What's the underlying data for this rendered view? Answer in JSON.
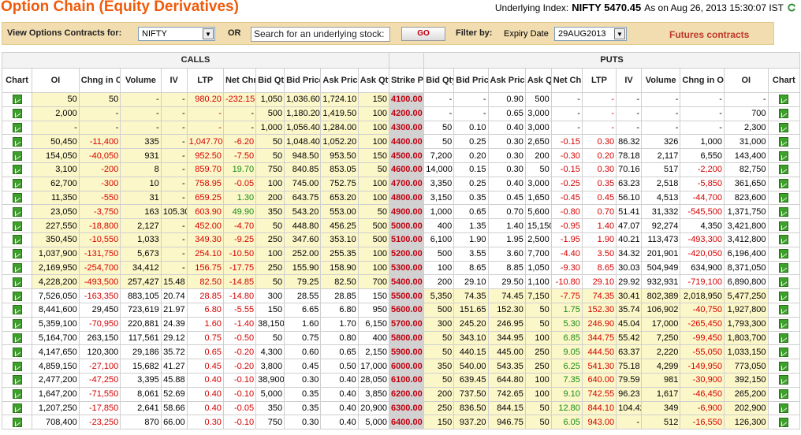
{
  "page": {
    "title": "Option Chain (Equity Derivatives)"
  },
  "underlying": {
    "label": "Underlying Index:",
    "symbol_value": "NIFTY 5470.45",
    "as_on": "As on Aug 26, 2013 15:30:07 IST"
  },
  "filter": {
    "view_label": "View Options Contracts for:",
    "symbol_selected": "NIFTY",
    "or_label": "OR",
    "search_value": "Search for an underlying stock:",
    "go_label": "GO",
    "filter_label": "Filter by:",
    "expiry_label": "Expiry Date",
    "expiry_selected": "29AUG2013",
    "futures_link": "Futures contracts"
  },
  "groups": {
    "calls": "CALLS",
    "puts": "PUTS"
  },
  "columns": {
    "calls": [
      "Chart",
      "OI",
      "Chng in OI",
      "Volume",
      "IV",
      "LTP",
      "Net Chng",
      "Bid Qty",
      "Bid Price",
      "Ask Price",
      "Ask Qty"
    ],
    "strike": "Strike Price",
    "puts": [
      "Bid Qty",
      "Bid Price",
      "Ask Price",
      "Ask Qty",
      "Net Chng",
      "LTP",
      "IV",
      "Volume",
      "Chng in OI",
      "OI",
      "Chart"
    ]
  },
  "icons": {
    "chart": "chart-icon",
    "refresh": "refresh-icon",
    "dropdown": "chevron-down-icon"
  },
  "colors": {
    "title": "#f05a0a",
    "itm": "#fcf7c8",
    "strike_bg": "#d2d2d2",
    "strike_text": "#c0000e",
    "negative": "#d60000",
    "positive": "#178a17",
    "chart_icon": "#3f9f2c"
  },
  "rows": [
    {
      "strike": "4100.00",
      "call": [
        "50",
        "50",
        "-",
        "-",
        "980.20",
        "-232.15",
        "1,050",
        "1,036.60",
        "1,724.10",
        "150"
      ],
      "put": [
        "-",
        "-",
        "0.90",
        "500",
        "-",
        "-",
        "-",
        "-",
        "-",
        "-"
      ]
    },
    {
      "strike": "4200.00",
      "call": [
        "2,000",
        "-",
        "-",
        "-",
        "-",
        "-",
        "500",
        "1,180.20",
        "1,419.50",
        "100"
      ],
      "put": [
        "-",
        "-",
        "0.65",
        "3,000",
        "-",
        "-",
        "-",
        "-",
        "-",
        "700"
      ]
    },
    {
      "strike": "4300.00",
      "call": [
        "-",
        "-",
        "-",
        "-",
        "-",
        "-",
        "1,000",
        "1,056.40",
        "1,284.00",
        "100"
      ],
      "put": [
        "50",
        "0.10",
        "0.40",
        "3,000",
        "-",
        "-",
        "-",
        "-",
        "-",
        "2,300"
      ]
    },
    {
      "strike": "4400.00",
      "call": [
        "50,450",
        "-11,400",
        "335",
        "-",
        "1,047.70",
        "-6.20",
        "50",
        "1,048.40",
        "1,052.20",
        "100"
      ],
      "put": [
        "50",
        "0.25",
        "0.30",
        "2,650",
        "-0.15",
        "0.30",
        "86.32",
        "326",
        "1,000",
        "31,000"
      ]
    },
    {
      "strike": "4500.00",
      "call": [
        "154,050",
        "-40,050",
        "931",
        "-",
        "952.50",
        "-7.50",
        "50",
        "948.50",
        "953.50",
        "150"
      ],
      "put": [
        "7,200",
        "0.20",
        "0.30",
        "200",
        "-0.30",
        "0.20",
        "78.18",
        "2,117",
        "6,550",
        "143,400"
      ]
    },
    {
      "strike": "4600.00",
      "call": [
        "3,100",
        "-200",
        "8",
        "-",
        "859.70",
        "19.70",
        "750",
        "840.85",
        "853.05",
        "50"
      ],
      "put": [
        "14,000",
        "0.15",
        "0.30",
        "50",
        "-0.15",
        "0.30",
        "70.16",
        "517",
        "-2,200",
        "82,750"
      ]
    },
    {
      "strike": "4700.00",
      "call": [
        "62,700",
        "-300",
        "10",
        "-",
        "758.95",
        "-0.05",
        "100",
        "745.00",
        "752.75",
        "100"
      ],
      "put": [
        "3,350",
        "0.25",
        "0.40",
        "3,000",
        "-0.25",
        "0.35",
        "63.23",
        "2,518",
        "-5,850",
        "361,650"
      ]
    },
    {
      "strike": "4800.00",
      "call": [
        "11,350",
        "-550",
        "31",
        "-",
        "659.25",
        "1.30",
        "200",
        "643.75",
        "653.20",
        "100"
      ],
      "put": [
        "3,150",
        "0.35",
        "0.45",
        "1,650",
        "-0.45",
        "0.45",
        "56.10",
        "4,513",
        "-44,700",
        "823,600"
      ]
    },
    {
      "strike": "4900.00",
      "call": [
        "23,050",
        "-3,750",
        "163",
        "105.30",
        "603.90",
        "49.90",
        "350",
        "543.20",
        "553.00",
        "50"
      ],
      "put": [
        "1,000",
        "0.65",
        "0.70",
        "5,600",
        "-0.80",
        "0.70",
        "51.41",
        "31,332",
        "-545,500",
        "1,371,750"
      ]
    },
    {
      "strike": "5000.00",
      "call": [
        "227,550",
        "-18,800",
        "2,127",
        "-",
        "452.00",
        "-4.70",
        "50",
        "448.80",
        "456.25",
        "500"
      ],
      "put": [
        "400",
        "1.35",
        "1.40",
        "15,150",
        "-0.95",
        "1.40",
        "47.07",
        "92,274",
        "4,350",
        "3,421,800"
      ]
    },
    {
      "strike": "5100.00",
      "call": [
        "350,450",
        "-10,550",
        "1,033",
        "-",
        "349.30",
        "-9.25",
        "250",
        "347.60",
        "353.10",
        "500"
      ],
      "put": [
        "6,100",
        "1.90",
        "1.95",
        "2,500",
        "-1.95",
        "1.90",
        "40.21",
        "113,473",
        "-493,300",
        "3,412,800"
      ]
    },
    {
      "strike": "5200.00",
      "call": [
        "1,037,900",
        "-131,750",
        "5,673",
        "-",
        "254.10",
        "-10.50",
        "100",
        "252.00",
        "255.35",
        "100"
      ],
      "put": [
        "500",
        "3.55",
        "3.60",
        "7,700",
        "-4.40",
        "3.50",
        "34.32",
        "201,901",
        "-420,050",
        "6,196,400"
      ]
    },
    {
      "strike": "5300.00",
      "call": [
        "2,169,950",
        "-254,700",
        "34,412",
        "-",
        "156.75",
        "-17.75",
        "250",
        "155.90",
        "158.90",
        "100"
      ],
      "put": [
        "100",
        "8.65",
        "8.85",
        "1,050",
        "-9.30",
        "8.65",
        "30.03",
        "504,949",
        "634,900",
        "8,371,050"
      ]
    },
    {
      "strike": "5400.00",
      "call": [
        "4,228,200",
        "-493,500",
        "257,427",
        "15.48",
        "82.50",
        "-14.85",
        "50",
        "79.25",
        "82.50",
        "700"
      ],
      "put": [
        "200",
        "29.10",
        "29.50",
        "1,100",
        "-10.80",
        "29.10",
        "29.92",
        "932,931",
        "-719,100",
        "6,890,800"
      ]
    },
    {
      "strike": "5500.00",
      "call": [
        "7,526,050",
        "-163,350",
        "883,105",
        "20.74",
        "28.85",
        "-14.80",
        "300",
        "28.55",
        "28.85",
        "150"
      ],
      "put": [
        "5,350",
        "74.35",
        "74.45",
        "7,150",
        "-7.75",
        "74.35",
        "30.41",
        "802,389",
        "2,018,950",
        "5,477,250"
      ]
    },
    {
      "strike": "5600.00",
      "call": [
        "8,441,600",
        "29,450",
        "723,619",
        "21.97",
        "6.80",
        "-5.55",
        "150",
        "6.65",
        "6.80",
        "950"
      ],
      "put": [
        "500",
        "151.65",
        "152.30",
        "50",
        "1.75",
        "152.30",
        "35.74",
        "106,902",
        "-40,750",
        "1,927,800"
      ]
    },
    {
      "strike": "5700.00",
      "call": [
        "5,359,100",
        "-70,950",
        "220,881",
        "24.39",
        "1.60",
        "-1.40",
        "38,150",
        "1.60",
        "1.70",
        "6,150"
      ],
      "put": [
        "300",
        "245.20",
        "246.95",
        "50",
        "5.30",
        "246.90",
        "45.04",
        "17,000",
        "-265,450",
        "1,793,300"
      ]
    },
    {
      "strike": "5800.00",
      "call": [
        "5,164,700",
        "263,150",
        "117,561",
        "29.12",
        "0.75",
        "-0.50",
        "50",
        "0.75",
        "0.80",
        "400"
      ],
      "put": [
        "50",
        "343.10",
        "344.95",
        "100",
        "6.85",
        "344.75",
        "55.42",
        "7,250",
        "-99,450",
        "1,803,700"
      ]
    },
    {
      "strike": "5900.00",
      "call": [
        "4,147,650",
        "120,300",
        "29,186",
        "35.72",
        "0.65",
        "-0.20",
        "4,300",
        "0.60",
        "0.65",
        "2,150"
      ],
      "put": [
        "50",
        "440.15",
        "445.00",
        "250",
        "9.05",
        "444.50",
        "63.37",
        "2,220",
        "-55,050",
        "1,033,150"
      ]
    },
    {
      "strike": "6000.00",
      "call": [
        "4,859,150",
        "-27,100",
        "15,682",
        "41.27",
        "0.45",
        "-0.20",
        "3,800",
        "0.45",
        "0.50",
        "17,000"
      ],
      "put": [
        "350",
        "540.00",
        "543.35",
        "250",
        "6.25",
        "541.30",
        "75.18",
        "4,299",
        "-149,950",
        "773,050"
      ]
    },
    {
      "strike": "6100.00",
      "call": [
        "2,477,200",
        "-47,250",
        "3,395",
        "45.88",
        "0.40",
        "-0.10",
        "38,900",
        "0.30",
        "0.40",
        "28,050"
      ],
      "put": [
        "50",
        "639.45",
        "644.80",
        "100",
        "7.35",
        "640.00",
        "79.59",
        "981",
        "-30,900",
        "392,150"
      ]
    },
    {
      "strike": "6200.00",
      "call": [
        "1,647,200",
        "-71,550",
        "8,061",
        "52.69",
        "0.40",
        "-0.10",
        "5,000",
        "0.35",
        "0.40",
        "3,850"
      ],
      "put": [
        "200",
        "737.50",
        "742.65",
        "100",
        "9.10",
        "742.55",
        "96.23",
        "1,617",
        "-46,450",
        "265,200"
      ]
    },
    {
      "strike": "6300.00",
      "call": [
        "1,207,250",
        "-17,850",
        "2,641",
        "58.66",
        "0.40",
        "-0.05",
        "350",
        "0.35",
        "0.40",
        "20,900"
      ],
      "put": [
        "250",
        "836.50",
        "844.15",
        "50",
        "12.80",
        "844.10",
        "104.42",
        "349",
        "-6,900",
        "202,900"
      ]
    },
    {
      "strike": "6400.00",
      "call": [
        "708,400",
        "-23,250",
        "870",
        "66.00",
        "0.30",
        "-0.10",
        "750",
        "0.30",
        "0.40",
        "5,000"
      ],
      "put": [
        "150",
        "937.20",
        "946.75",
        "50",
        "6.05",
        "943.00",
        "-",
        "512",
        "-16,550",
        "126,300"
      ]
    }
  ]
}
